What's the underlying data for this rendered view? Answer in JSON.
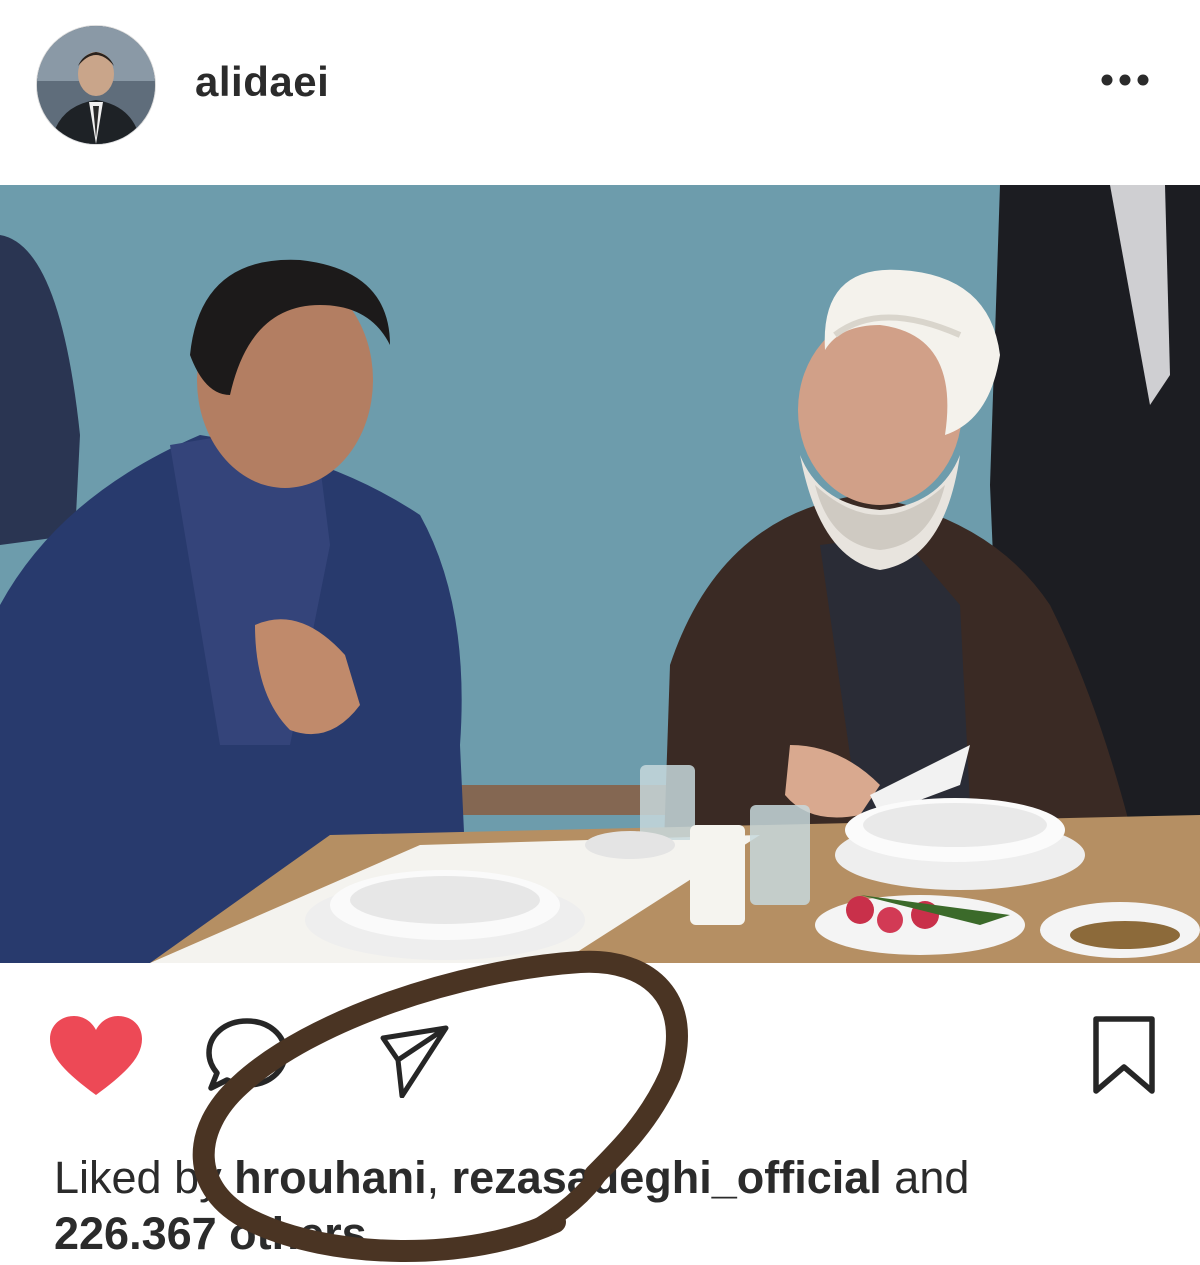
{
  "post": {
    "username": "alidaei",
    "more_label": "•••"
  },
  "icons": {
    "avatar": "avatar-photo",
    "more": "more-options-icon",
    "like": "heart-icon",
    "comment": "comment-bubble-icon",
    "share": "paper-plane-icon",
    "save": "bookmark-icon"
  },
  "likes": {
    "prefix": "Liked by ",
    "user1": "hrouhani",
    "separator": ", ",
    "user2": "rezasadeghi_official",
    "conjunction": " and",
    "count": "226.367",
    "others": " others"
  },
  "colors": {
    "like_active": "#ed4956",
    "marker": "#4a3423",
    "wall": "#6f9dad"
  }
}
